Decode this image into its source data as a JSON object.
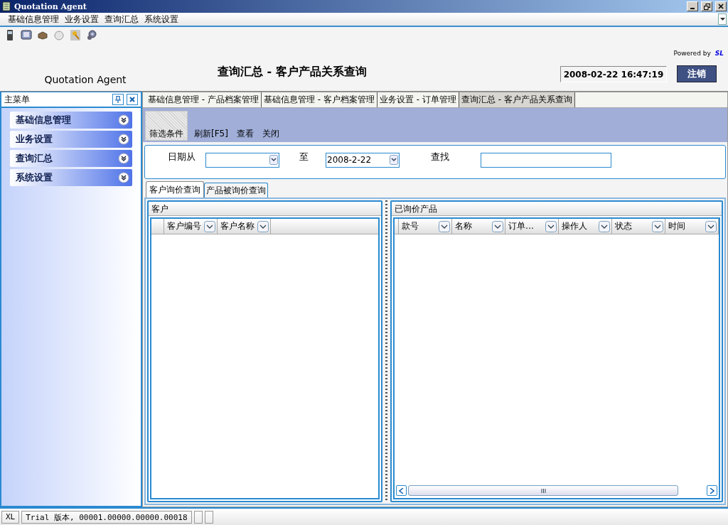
{
  "window": {
    "title": "Quotation Agent"
  },
  "menu_bar": [
    {
      "label": "基础信息管理"
    },
    {
      "label": "业务设置"
    },
    {
      "label": "查询汇总"
    },
    {
      "label": "系统设置"
    }
  ],
  "header": {
    "app_name": "Quotation Agent",
    "page_title": "查询汇总 - 客户产品关系查询",
    "powered_by": "Powered by",
    "brand": "SL",
    "datetime": "2008-02-22 16:47:19",
    "logout_button": "注销"
  },
  "sidebar": {
    "title": "主菜单",
    "items": [
      {
        "label": "基础信息管理"
      },
      {
        "label": "业务设置"
      },
      {
        "label": "查询汇总"
      },
      {
        "label": "系统设置"
      }
    ]
  },
  "document_tabs": [
    {
      "label": "基础信息管理 - 产品档案管理",
      "selected": false
    },
    {
      "label": "基础信息管理 - 客户档案管理",
      "selected": false
    },
    {
      "label": "业务设置 - 订单管理",
      "selected": false
    },
    {
      "label": "查询汇总 - 客户产品关系查询",
      "selected": true
    }
  ],
  "toolbar": [
    {
      "label": "筛选条件",
      "selected": true
    },
    {
      "label": "刷新[F5]",
      "selected": false
    },
    {
      "label": "查看",
      "selected": false
    },
    {
      "label": "关闭",
      "selected": false
    }
  ],
  "filter": [
    {
      "label": "日期从",
      "kind": "combo"
    },
    {
      "label": "至",
      "kind": "combo",
      "value": "2008-2-22"
    },
    {
      "label": "查找",
      "kind": "text"
    }
  ],
  "inner_tabs": [
    {
      "label": "客户询价查询",
      "selected": true
    },
    {
      "label": "产品被询价查询",
      "selected": false
    }
  ],
  "customer_grid": {
    "title": "客户",
    "columns": [
      "客户编号",
      "客户名称"
    ]
  },
  "product_grid": {
    "title": "已询价产品",
    "columns": [
      "款号",
      "名称",
      "订单…",
      "操作人",
      "状态",
      "时间"
    ]
  },
  "status_bar": [
    "XL",
    "Trial 版本, 00001.00000.00000.00018"
  ]
}
